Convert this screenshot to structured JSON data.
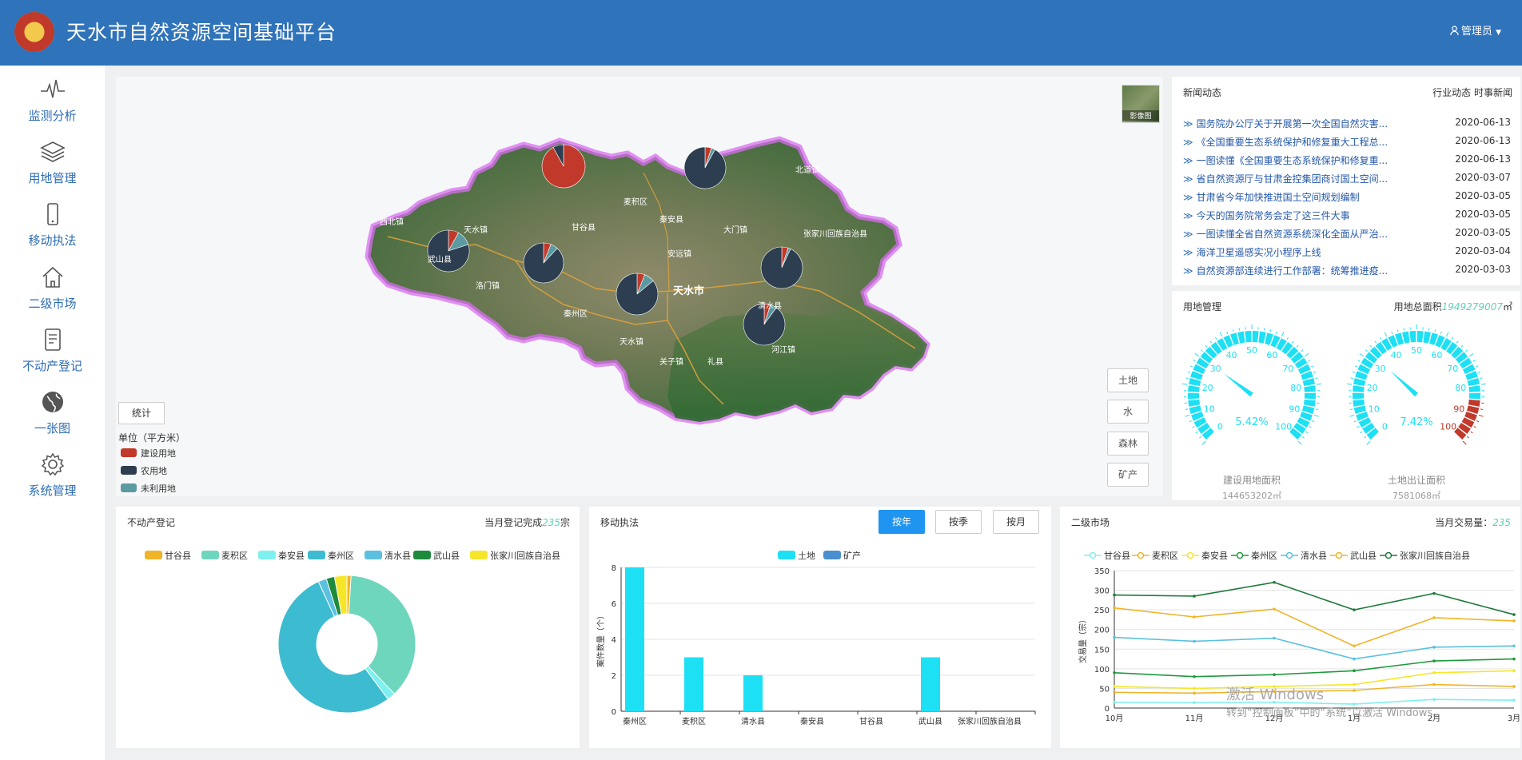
{
  "header": {
    "title": "天水市自然资源空间基础平台",
    "user": "管理员"
  },
  "sidebar": {
    "items": [
      {
        "label": "监测分析",
        "icon": "pulse-icon"
      },
      {
        "label": "用地管理",
        "icon": "layers-icon"
      },
      {
        "label": "移动执法",
        "icon": "mobile-icon"
      },
      {
        "label": "二级市场",
        "icon": "home-icon"
      },
      {
        "label": "不动产登记",
        "icon": "document-icon"
      },
      {
        "label": "一张图",
        "icon": "globe-icon"
      },
      {
        "label": "系统管理",
        "icon": "gear-icon"
      }
    ]
  },
  "map": {
    "thumb_label": "影像图",
    "layers": [
      "土地",
      "水",
      "森林",
      "矿产"
    ],
    "stat_button": "统计",
    "legend_unit": "单位（平方米）",
    "legend": [
      {
        "label": "建设用地",
        "color": "#c0392b"
      },
      {
        "label": "农用地",
        "color": "#2c3e50"
      },
      {
        "label": "未利用地",
        "color": "#5b9aa0"
      }
    ],
    "city_label": "天水市",
    "places": [
      "秦安县",
      "甘谷县",
      "武山县",
      "清水县",
      "张家川回族自治县",
      "麦积区",
      "秦州区",
      "天水镇",
      "西北镇",
      "天水镇",
      "关子镇",
      "洛门镇",
      "礼县",
      "安远镇",
      "大门镇",
      "河江镇",
      "北道镇"
    ]
  },
  "news": {
    "title": "新闻动态",
    "tabs": "行业动态  时事新闻",
    "items": [
      {
        "title": "国务院办公厅关于开展第一次全国自然灾害...",
        "date": "2020-06-13"
      },
      {
        "title": "《全国重要生态系统保护和修复重大工程总...",
        "date": "2020-06-13"
      },
      {
        "title": "一图读懂《全国重要生态系统保护和修复重...",
        "date": "2020-06-13"
      },
      {
        "title": "省自然资源厅与甘肃金控集团商讨国土空间...",
        "date": "2020-03-07"
      },
      {
        "title": "甘肃省今年加快推进国土空间规划编制",
        "date": "2020-03-05"
      },
      {
        "title": "今天的国务院常务会定了这三件大事",
        "date": "2020-03-05"
      },
      {
        "title": "一图读懂全省自然资源系统深化全面从严治...",
        "date": "2020-03-05"
      },
      {
        "title": "海洋卫星遥感实况小程序上线",
        "date": "2020-03-04"
      },
      {
        "title": "自然资源部连续进行工作部署：统筹推进疫...",
        "date": "2020-03-03"
      }
    ]
  },
  "land": {
    "title": "用地管理",
    "total_label": "用地总面积",
    "total_value": "1949279007",
    "total_unit": "㎡",
    "gauges": [
      {
        "name": "建设用地面积",
        "percent": 5.42,
        "percent_text": "5.42%",
        "value": "144653202㎡"
      },
      {
        "name": "土地出让面积",
        "percent": 7.42,
        "percent_text": "7.42%",
        "value": "7581068㎡"
      }
    ],
    "ticks": [
      "0",
      "10",
      "20",
      "30",
      "40",
      "50",
      "60",
      "70",
      "80",
      "90",
      "100"
    ]
  },
  "realestate": {
    "title": "不动产登记",
    "summary_label": "当月登记完成",
    "summary_value": "235",
    "summary_unit": "宗",
    "legend": [
      {
        "label": "甘谷县",
        "color": "#f0b429"
      },
      {
        "label": "麦积区",
        "color": "#6fd6be"
      },
      {
        "label": "秦安县",
        "color": "#7ff0f0"
      },
      {
        "label": "秦州区",
        "color": "#3dbbd0"
      },
      {
        "label": "清水县",
        "color": "#5cc0e0"
      },
      {
        "label": "武山县",
        "color": "#1e8a3c"
      },
      {
        "label": "张家川回族自治县",
        "color": "#f5e62a"
      }
    ]
  },
  "enforcement": {
    "title": "移动执法",
    "buttons": [
      "按年",
      "按季",
      "按月"
    ],
    "legend": [
      {
        "label": "土地",
        "color": "#1ee0f5"
      },
      {
        "label": "矿产",
        "color": "#4a8fd0"
      }
    ],
    "ylabel": "案件数量（个）"
  },
  "market": {
    "title": "二级市场",
    "summary_label": "当月交易量：",
    "summary_value": "235",
    "ylabel": "交易量（宗）",
    "legend": [
      {
        "label": "甘谷县",
        "color": "#7ff0f0"
      },
      {
        "label": "麦积区",
        "color": "#f0b429"
      },
      {
        "label": "秦安县",
        "color": "#f5e62a"
      },
      {
        "label": "秦州区",
        "color": "#1e9a3c"
      },
      {
        "label": "清水县",
        "color": "#5cc0e0"
      },
      {
        "label": "武山县",
        "color": "#f0b429"
      },
      {
        "label": "张家川回族自治县",
        "color": "#1e7a3c"
      }
    ]
  },
  "watermark": {
    "line1": "激活 Windows",
    "line2": "转到“控制面板”中的“系统”以激活 Windows。"
  },
  "chart_data": [
    {
      "type": "pie",
      "title": "不动产登记",
      "categories": [
        "甘谷县",
        "麦积区",
        "秦安县",
        "秦州区",
        "清水县",
        "武山县",
        "张家川回族自治县"
      ],
      "values": [
        1,
        38,
        2,
        55,
        2,
        2,
        3
      ],
      "donut": true
    },
    {
      "type": "bar",
      "title": "移动执法",
      "categories": [
        "秦州区",
        "麦积区",
        "清水县",
        "秦安县",
        "甘谷县",
        "武山县",
        "张家川回族自治县"
      ],
      "series": [
        {
          "name": "土地",
          "values": [
            8,
            3,
            2,
            0,
            0,
            3,
            0
          ]
        },
        {
          "name": "矿产",
          "values": [
            0,
            0,
            0,
            0,
            0,
            0,
            0
          ]
        }
      ],
      "ylabel": "案件数量（个）",
      "ylim": [
        0,
        8
      ],
      "yticks": [
        0,
        2,
        4,
        6,
        8
      ]
    },
    {
      "type": "line",
      "title": "二级市场",
      "categories": [
        "10月",
        "11月",
        "12月",
        "1月",
        "2月",
        "3月"
      ],
      "series": [
        {
          "name": "甘谷县",
          "values": [
            15,
            14,
            15,
            10,
            22,
            20
          ]
        },
        {
          "name": "麦积区",
          "values": [
            40,
            38,
            42,
            45,
            60,
            55
          ]
        },
        {
          "name": "秦安县",
          "values": [
            55,
            50,
            55,
            60,
            90,
            95
          ]
        },
        {
          "name": "秦州区",
          "values": [
            90,
            80,
            85,
            95,
            120,
            125
          ]
        },
        {
          "name": "清水县",
          "values": [
            180,
            170,
            178,
            125,
            155,
            158
          ]
        },
        {
          "name": "武山县",
          "values": [
            255,
            232,
            252,
            158,
            230,
            222
          ]
        },
        {
          "name": "张家川回族自治县",
          "values": [
            288,
            285,
            320,
            250,
            292,
            238
          ]
        }
      ],
      "ylabel": "交易量（宗）",
      "ylim": [
        0,
        350
      ],
      "yticks": [
        0,
        50,
        100,
        150,
        200,
        250,
        300,
        350
      ]
    }
  ]
}
